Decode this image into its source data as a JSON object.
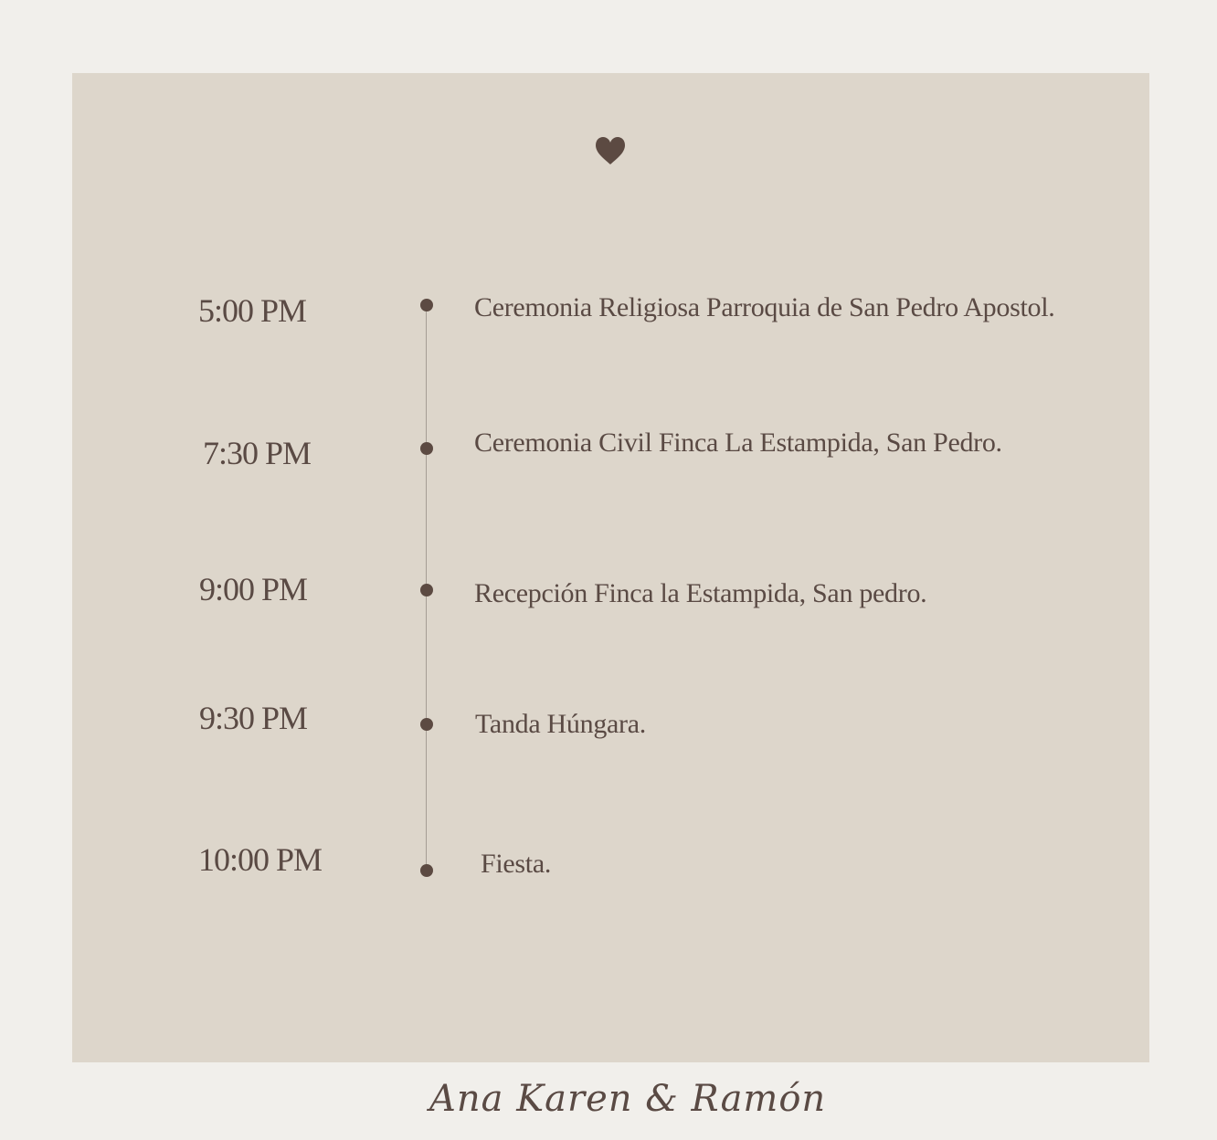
{
  "heart_icon": "heart-icon",
  "colors": {
    "background": "#f1efeb",
    "card": "#ddd6cb",
    "text": "#5a4a44",
    "dot": "#5c4a42",
    "line": "#a59d94"
  },
  "schedule": [
    {
      "time": "5:00 PM",
      "description": "Ceremonia Religiosa Parroquia de San Pedro Apostol."
    },
    {
      "time": "7:30 PM",
      "description": "Ceremonia Civil Finca La Estampida, San Pedro."
    },
    {
      "time": "9:00 PM",
      "description": "Recepción Finca la Estampida, San pedro."
    },
    {
      "time": "9:30 PM",
      "description": "Tanda Húngara."
    },
    {
      "time": "10:00 PM",
      "description": "Fiesta."
    }
  ],
  "signature": "Ana Karen & Ramón"
}
